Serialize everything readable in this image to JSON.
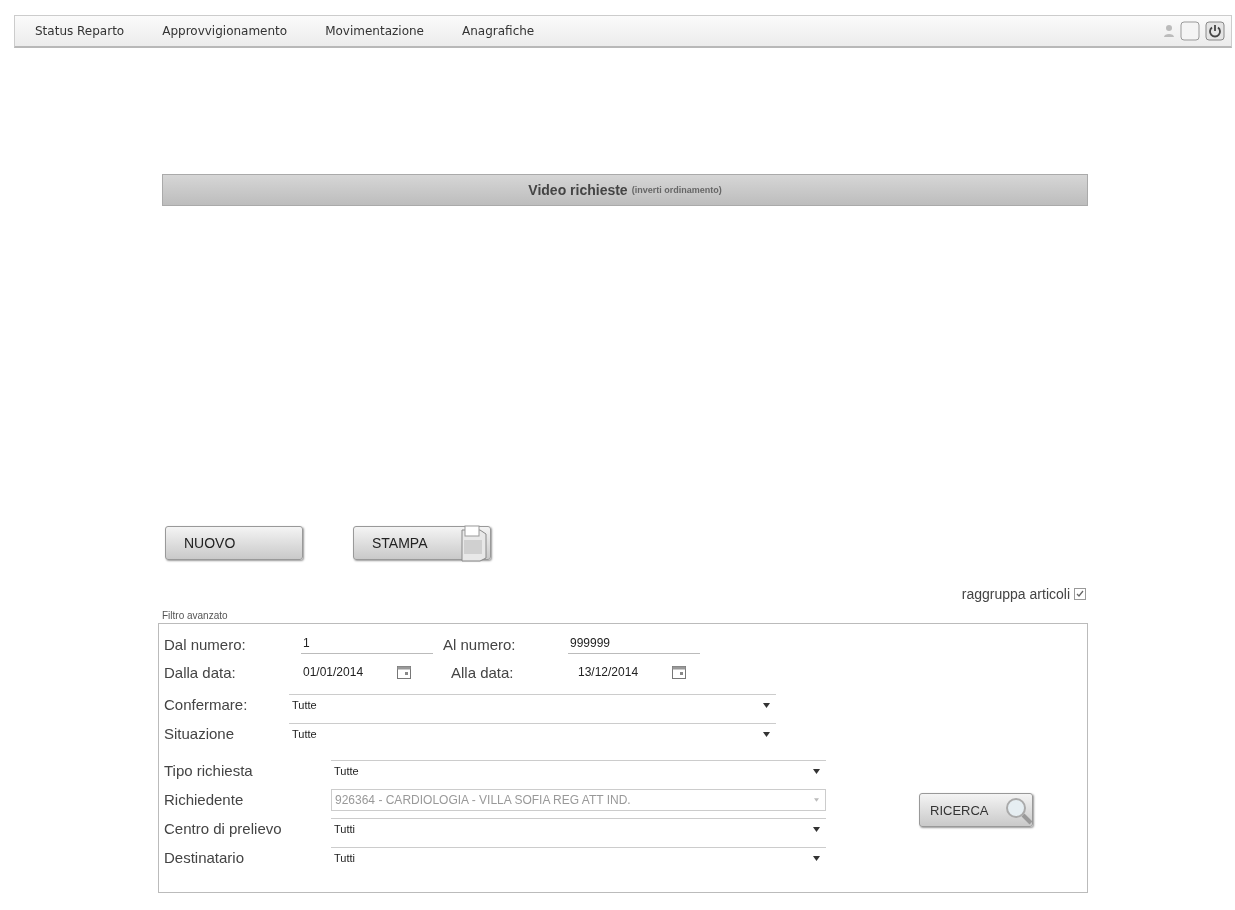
{
  "nav": {
    "items": [
      {
        "label": "Status Reparto"
      },
      {
        "label": "Approvvigionamento"
      },
      {
        "label": "Movimentazione"
      },
      {
        "label": "Anagrafiche"
      }
    ]
  },
  "header": {
    "title": "Video richieste",
    "link": "(inverti ordinamento)"
  },
  "actions": [
    {
      "label": "NUOVO",
      "kind": "plain"
    },
    {
      "label": "STAMPA",
      "kind": "print"
    }
  ],
  "group_articles": {
    "label": "raggruppa articoli",
    "checked": true
  },
  "filter": {
    "legend": "Filtro avanzato",
    "pairs": [
      [
        {
          "label": "Dal numero:",
          "value": "1",
          "kind": "number"
        },
        {
          "label": "Al numero:",
          "value": "999999",
          "kind": "number"
        }
      ],
      [
        {
          "label": "Dalla data:",
          "value": "01/01/2014",
          "kind": "date"
        },
        {
          "label": "Alla data:",
          "value": "13/12/2014",
          "kind": "date"
        }
      ]
    ],
    "selects_a": [
      {
        "label": "Confermare:",
        "value": "Tutte",
        "disabled": false
      },
      {
        "label": "Situazione",
        "value": "Tutte",
        "disabled": false
      }
    ],
    "selects_b": [
      {
        "label": "Tipo richiesta",
        "value": "Tutte",
        "disabled": false
      },
      {
        "label": "Richiedente",
        "value": "926364 - CARDIOLOGIA - VILLA SOFIA REG ATT IND.",
        "disabled": true
      },
      {
        "label": "Centro di prelievo",
        "value": "Tutti",
        "disabled": false
      },
      {
        "label": "Destinatario",
        "value": "Tutti",
        "disabled": false
      }
    ],
    "search_button": "RICERCA"
  }
}
